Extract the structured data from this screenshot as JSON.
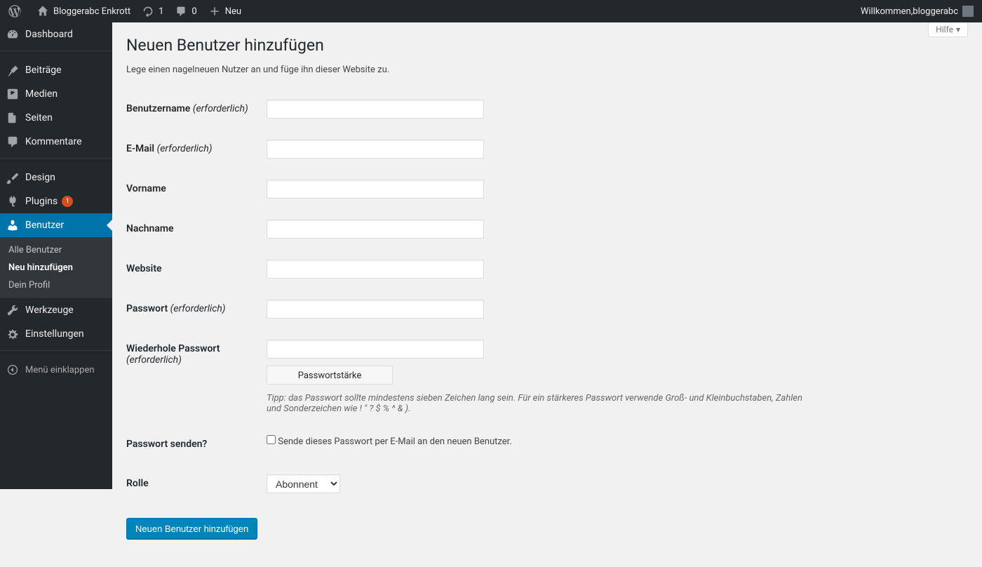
{
  "adminbar": {
    "site_name": "Bloggerabc Enkrott",
    "updates_count": "1",
    "comments_count": "0",
    "new_label": "Neu",
    "welcome_prefix": "Willkommen, ",
    "welcome_user": "bloggerabc"
  },
  "help_tab": {
    "label": "Hilfe"
  },
  "menu": {
    "dashboard": "Dashboard",
    "posts": "Beiträge",
    "media": "Medien",
    "pages": "Seiten",
    "comments": "Kommentare",
    "appearance": "Design",
    "plugins": "Plugins",
    "plugins_badge": "1",
    "users": "Benutzer",
    "users_sub": {
      "all": "Alle Benutzer",
      "add": "Neu hinzufügen",
      "profile": "Dein Profil"
    },
    "tools": "Werkzeuge",
    "settings": "Einstellungen",
    "collapse": "Menü einklappen"
  },
  "page": {
    "title": "Neuen Benutzer hinzufügen",
    "description": "Lege einen nagelneuen Nutzer an und füge ihn dieser Website zu.",
    "required": "(erforderlich)",
    "labels": {
      "username": "Benutzername",
      "email": "E-Mail",
      "first_name": "Vorname",
      "last_name": "Nachname",
      "website": "Website",
      "password": "Passwort",
      "password2": "Wiederhole Passwort",
      "send_password": "Passwort senden?",
      "role": "Rolle"
    },
    "password_strength": "Passwortstärke",
    "password_hint": "Tipp: das Passwort sollte mindestens sieben Zeichen lang sein. Für ein stärkeres Passwort verwende Groß- und Kleinbuchstaben, Zahlen und Sonderzeichen wie ! \" ? $ % ^ & ).",
    "send_password_checkbox": "Sende dieses Passwort per E-Mail an den neuen Benutzer.",
    "role_selected": "Abonnent",
    "submit": "Neuen Benutzer hinzufügen"
  }
}
